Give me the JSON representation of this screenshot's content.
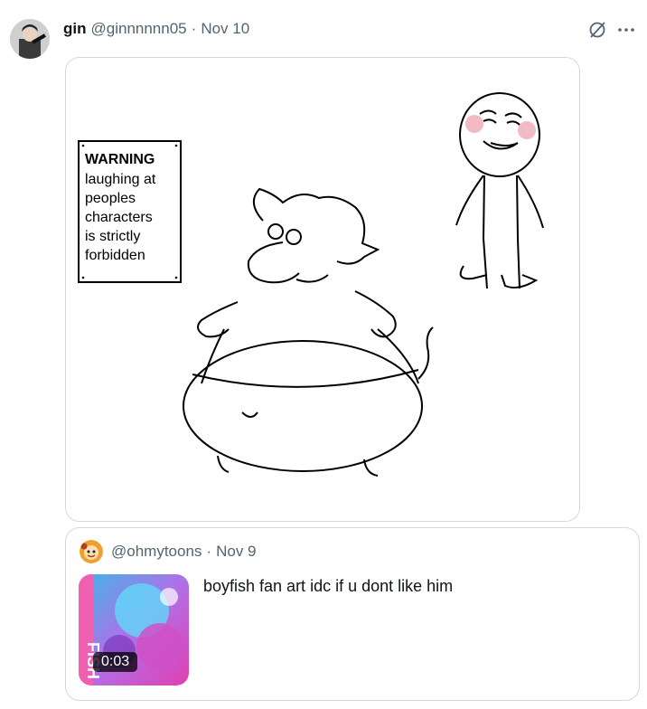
{
  "tweet": {
    "author_name": "gin",
    "handle": "@ginnnnnn05",
    "separator": "·",
    "date": "Nov 10",
    "header_icons": [
      "grok-icon",
      "more-dots-icon"
    ],
    "image_sign": {
      "lines": [
        "WARNING",
        "laughing at",
        "peoples",
        "characters",
        "is strictly",
        "forbidden"
      ]
    }
  },
  "quote": {
    "handle": "@ohmytoons",
    "separator": "·",
    "date": "Nov 9",
    "text": "boyfish fan art idc if u dont like him",
    "video_duration": "0:03",
    "thumb_text": "FISH"
  },
  "colors": {
    "text_primary": "#0f1419",
    "text_secondary": "#536471",
    "border": "#cfd9de"
  }
}
